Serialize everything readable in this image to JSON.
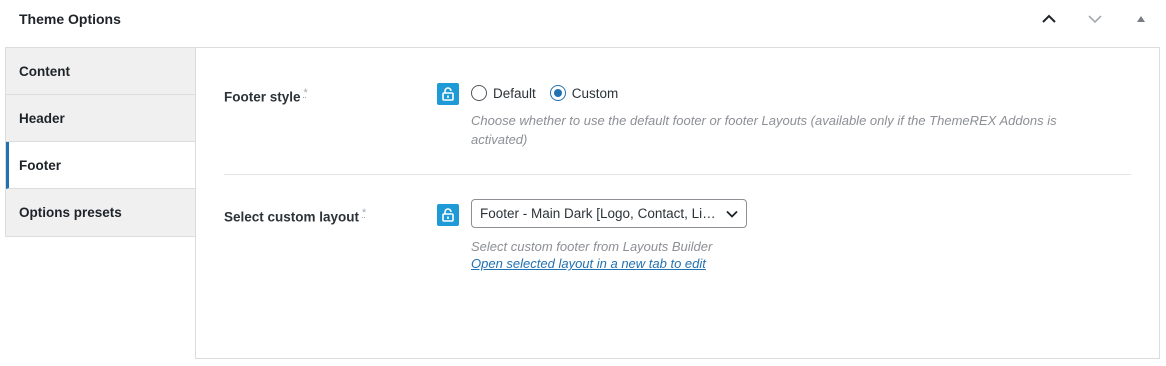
{
  "panel": {
    "title": "Theme Options"
  },
  "tabs": [
    {
      "label": "Content"
    },
    {
      "label": "Header"
    },
    {
      "label": "Footer",
      "active": true
    },
    {
      "label": "Options presets"
    }
  ],
  "footer_style": {
    "label": "Footer style",
    "required_mark": "*",
    "options": [
      {
        "label": "Default",
        "checked": false
      },
      {
        "label": "Custom",
        "checked": true
      }
    ],
    "description": "Choose whether to use the default footer or footer Layouts (available only if the ThemeREX Addons is activated)"
  },
  "custom_layout": {
    "label": "Select custom layout",
    "required_mark": "*",
    "selected": "Footer - Main Dark [Logo, Contact, Links]",
    "description": "Select custom footer from Layouts Builder",
    "link_text": "Open selected layout in a new tab to edit"
  },
  "colors": {
    "accent": "#2271b1",
    "lock_button": "#1e9bd7",
    "description_text": "#8c8f94"
  },
  "icons": [
    "chevron-up-icon",
    "chevron-down-icon",
    "triangle-up-icon",
    "unlock-icon",
    "chevron-down-icon"
  ]
}
